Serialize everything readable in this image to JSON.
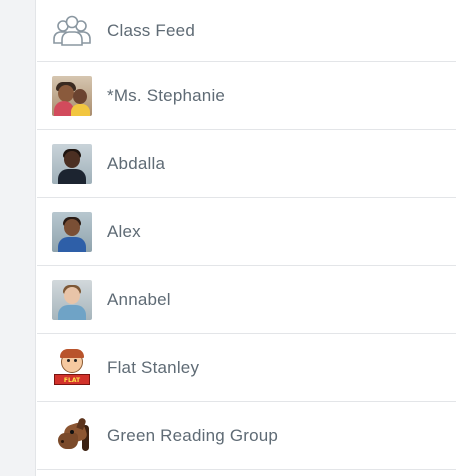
{
  "feed_list": {
    "items": [
      {
        "label": "Class Feed",
        "icon": "class-group-icon"
      },
      {
        "label": "*Ms. Stephanie",
        "icon": "teacher-photo"
      },
      {
        "label": "Abdalla",
        "icon": "student-photo"
      },
      {
        "label": "Alex",
        "icon": "student-photo"
      },
      {
        "label": "Annabel",
        "icon": "student-photo"
      },
      {
        "label": "Flat Stanley",
        "icon": "flat-stanley-avatar",
        "badge_text": "FLAT STANLEY"
      },
      {
        "label": "Green Reading Group",
        "icon": "horse-icon"
      }
    ]
  },
  "colors": {
    "label_text": "#5f6b75",
    "divider": "#e3e5e8",
    "gutter": "#f2f3f5",
    "icon_stroke": "#8a97a1"
  }
}
